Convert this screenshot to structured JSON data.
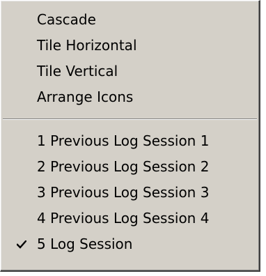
{
  "menu": {
    "window_items": [
      {
        "label": "Cascade"
      },
      {
        "label": "Tile Horizontal"
      },
      {
        "label": "Tile Vertical"
      },
      {
        "label": "Arrange Icons"
      }
    ],
    "session_items": [
      {
        "label": "1 Previous Log Session 1",
        "checked": false
      },
      {
        "label": "2 Previous Log Session 2",
        "checked": false
      },
      {
        "label": "3 Previous Log Session 3",
        "checked": false
      },
      {
        "label": "4 Previous Log Session 4",
        "checked": false
      },
      {
        "label": "5 Log Session",
        "checked": true
      }
    ]
  },
  "icons": {
    "checked_item": "checkmark-icon"
  },
  "colors": {
    "menu_background": "#d4d0c8",
    "text": "#000000",
    "separator_dark": "#808080",
    "separator_light": "#ffffff"
  }
}
